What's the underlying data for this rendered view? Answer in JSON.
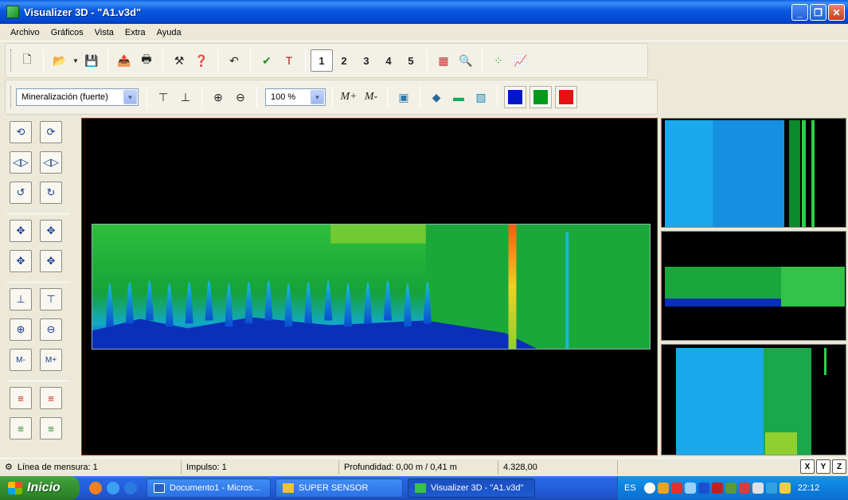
{
  "window": {
    "title": "Visualizer 3D - \"A1.v3d\""
  },
  "menu": [
    "Archivo",
    "Gráficos",
    "Vista",
    "Extra",
    "Ayuda"
  ],
  "toolbar1": {
    "views": [
      "1",
      "2",
      "3",
      "4",
      "5"
    ],
    "pressed_view": "1"
  },
  "toolbar2": {
    "mode_select": "Mineralización (fuerte)",
    "zoom_select": "100 %",
    "contrast_up_label": "M+",
    "contrast_down_label": "M-",
    "colors": [
      "#0018c8",
      "#009a1a",
      "#e81010"
    ]
  },
  "status": {
    "line": "Línea de mensura: 1",
    "impulse": "Impulso: 1",
    "depth": "Profundidad: 0,00 m / 0,41 m",
    "value": "4.328,00",
    "axes": [
      "X",
      "Y",
      "Z"
    ]
  },
  "taskbar": {
    "start": "Inicio",
    "tasks": [
      "Documento1 - Micros...",
      "SUPER SENSOR",
      "Visualizer 3D - \"A1.v3d\""
    ],
    "active_task": "Visualizer 3D - \"A1.v3d\"",
    "lang": "ES",
    "clock": "22:12"
  },
  "scan": {
    "legend": "mineralization heat map",
    "colors": [
      "#0a2fb8",
      "#18a8e8",
      "#14b83a",
      "#f0e020",
      "#f06010"
    ]
  }
}
